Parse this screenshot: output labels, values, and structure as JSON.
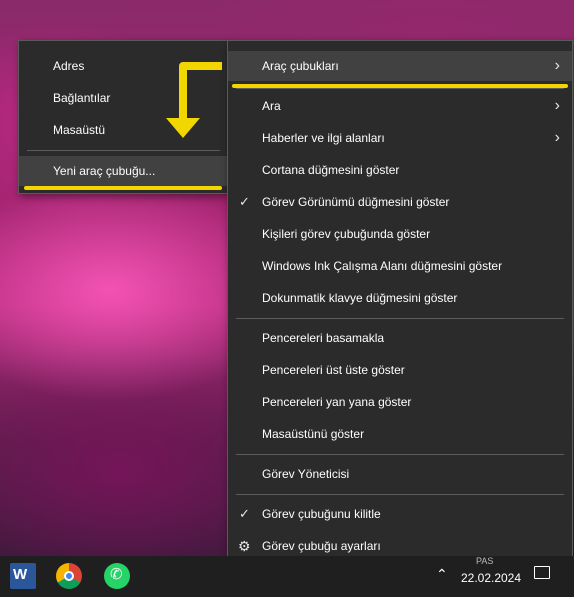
{
  "toolbar_submenu": {
    "items": [
      "Adres",
      "Bağlantılar",
      "Masaüstü"
    ],
    "new_toolbar": "Yeni araç çubuğu..."
  },
  "context_menu": {
    "toolbars": "Araç çubukları",
    "group1": [
      {
        "label": "Ara",
        "submenu": true
      },
      {
        "label": "Haberler ve ilgi alanları",
        "submenu": true
      },
      {
        "label": "Cortana düğmesini göster"
      },
      {
        "label": "Görev Görünümü düğmesini göster",
        "checked": true
      },
      {
        "label": "Kişileri görev çubuğunda göster"
      },
      {
        "label": "Windows Ink Çalışma Alanı düğmesini göster"
      },
      {
        "label": "Dokunmatik klavye düğmesini göster"
      }
    ],
    "group2": [
      "Pencereleri basamakla",
      "Pencereleri üst üste göster",
      "Pencereleri yan yana göster",
      "Masaüstünü göster"
    ],
    "task_manager": "Görev Yöneticisi",
    "lock_taskbar": "Görev çubuğunu kilitle",
    "taskbar_settings": "Görev çubuğu ayarları"
  },
  "taskbar": {
    "apps": [
      "word-icon",
      "chrome-icon",
      "whatsapp-icon"
    ],
    "word_letter": "W",
    "clock_time": "PAS",
    "clock_date": "22.02.2024"
  },
  "icons": {
    "chevron": "›",
    "check": "✓",
    "gear": "⚙",
    "tray_up": "⌃"
  },
  "colors": {
    "menu_bg": "#2b2b2b",
    "highlight": "#414141",
    "annotation": "#f2d600"
  }
}
